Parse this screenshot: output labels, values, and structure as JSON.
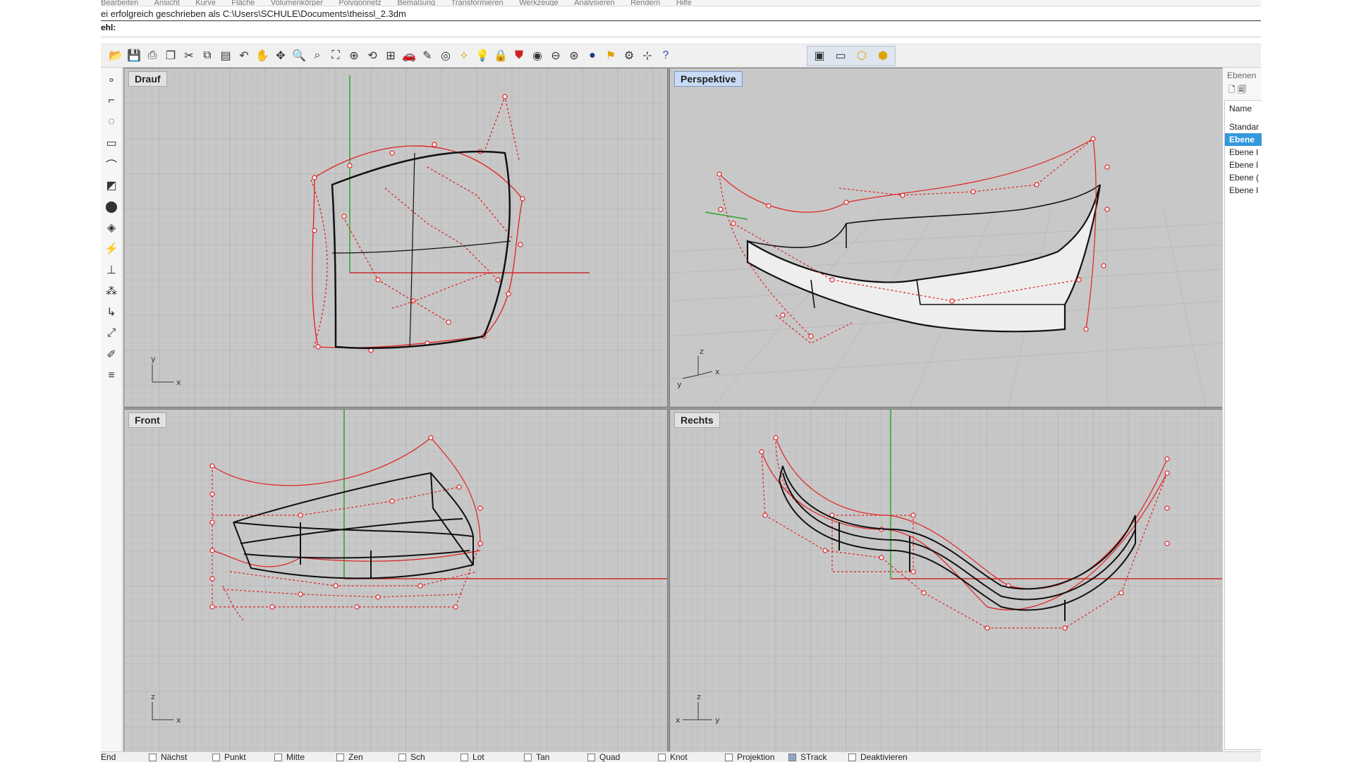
{
  "menubar": {
    "items": [
      "Bearbeiten",
      "Ansicht",
      "Kurve",
      "Fläche",
      "Volumenkörper",
      "Polygonnetz",
      "Bemaßung",
      "Transformieren",
      "Werkzeuge",
      "Analysieren",
      "Rendern",
      "Hilfe"
    ]
  },
  "command": {
    "history": "ei erfolgreich geschrieben als C:\\Users\\SCHULE\\Documents\\theissl_2.3dm",
    "prompt": "ehl:"
  },
  "toolbar": {
    "icons": [
      "open-icon",
      "save-icon",
      "print-icon",
      "import-icon",
      "cut-icon",
      "copy-icon",
      "paste-icon",
      "undo-icon",
      "pan-hand-icon",
      "move-icon",
      "zoom-icon",
      "zoom-window-icon",
      "zoom-extents-icon",
      "zoom-selected-icon",
      "rotate-view-icon",
      "four-viewports-icon",
      "car-icon",
      "tools-icon",
      "target-icon",
      "snap-icon",
      "light-bulb-icon",
      "lock-icon",
      "shield-icon",
      "color-wheel-icon",
      "wireframe-sphere-icon",
      "rendered-sphere-icon",
      "shaded-sphere-icon",
      "flag-icon",
      "gear-icon",
      "grid-icon",
      "help-icon"
    ],
    "group_icons": [
      "viewport-icon-1",
      "viewport-icon-2",
      "viewport-icon-3",
      "viewport-icon-4"
    ],
    "accent": "#f2c300"
  },
  "left_toolbar": {
    "icons": [
      "point-icon",
      "polyline-icon",
      "circle-icon",
      "rectangle-icon",
      "curve-icon",
      "surface-icon",
      "solid-icon",
      "mesh-icon",
      "lightning-icon",
      "dimension-icon",
      "transform-icon",
      "fillet-icon",
      "scale-icon",
      "edit-icon",
      "more-icon"
    ]
  },
  "viewports": {
    "top": {
      "title": "Drauf",
      "axis_a": "y",
      "axis_b": "x"
    },
    "perspective": {
      "title": "Perspektive",
      "axis_a": "z",
      "axis_b": "y",
      "axis_c": "x"
    },
    "front": {
      "title": "Front",
      "axis_a": "z",
      "axis_b": "x"
    },
    "right": {
      "title": "Rechts",
      "axis_a": "z",
      "axis_b": "x",
      "axis_c": "y"
    }
  },
  "layers": {
    "title": "Ebenen",
    "column": "Name",
    "rows": [
      "Standar",
      "Ebene",
      "Ebene I",
      "Ebene I",
      "Ebene (",
      "Ebene I"
    ]
  },
  "statusbar": {
    "snaps": [
      {
        "label": "End",
        "checked": false
      },
      {
        "label": "Nächst",
        "checked": false
      },
      {
        "label": "Punkt",
        "checked": false
      },
      {
        "label": "Mitte",
        "checked": false
      },
      {
        "label": "Zen",
        "checked": false
      },
      {
        "label": "Sch",
        "checked": false
      },
      {
        "label": "Lot",
        "checked": false
      },
      {
        "label": "Tan",
        "checked": false
      },
      {
        "label": "Quad",
        "checked": false
      },
      {
        "label": "Knot",
        "checked": false
      },
      {
        "label": "Projektion",
        "checked": false
      },
      {
        "label": "STrack",
        "checked": true
      },
      {
        "label": "Deaktivieren",
        "checked": false
      }
    ]
  },
  "colors": {
    "control": "#e02020",
    "curve": "#111111",
    "axis_x": "#cc2a2a",
    "axis_y": "#2ea32e",
    "grid": "#b5b5b5",
    "viewport_bg": "#c8c8c8"
  }
}
